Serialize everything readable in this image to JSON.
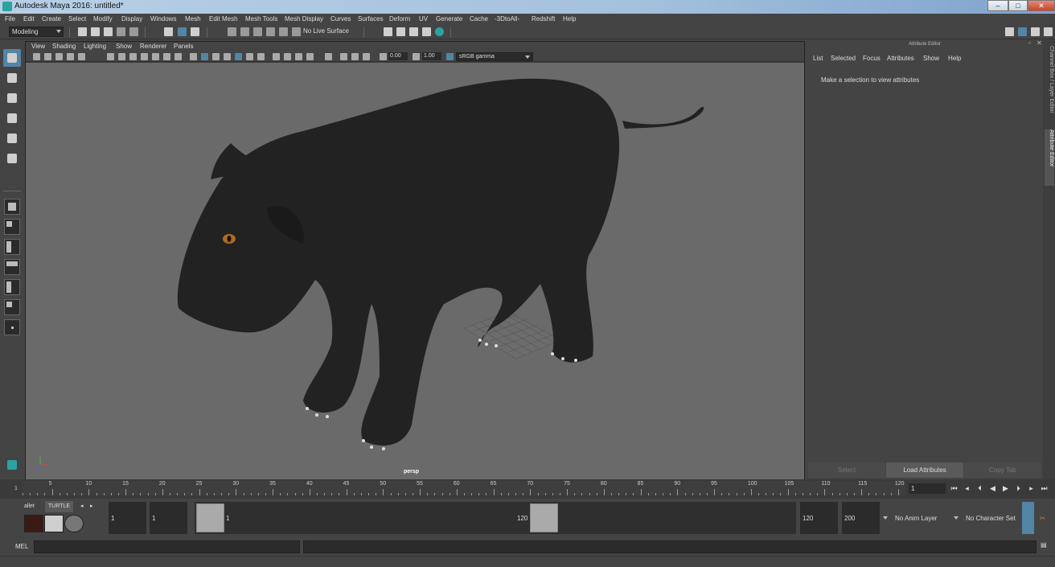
{
  "window": {
    "title": "Autodesk Maya 2016: untitled*",
    "controls": [
      "–",
      "□",
      "✕"
    ]
  },
  "menubar": [
    "File",
    "Edit",
    "Create",
    "Select",
    "Modify",
    "Display",
    "Windows",
    "Mesh",
    "Edit Mesh",
    "Mesh Tools",
    "Mesh Display",
    "Curves",
    "Surfaces",
    "Deform",
    "UV",
    "Generate",
    "Cache",
    "-3DtoAll-",
    "Redshift",
    "Help"
  ],
  "status_line": {
    "mode": "Modeling",
    "live_surface": "No Live Surface"
  },
  "viewport": {
    "menu": [
      "View",
      "Shading",
      "Lighting",
      "Show",
      "Renderer",
      "Panels"
    ],
    "exposure": "0.00",
    "gamma_value": "1.00",
    "color_space": "sRGB gamma",
    "camera": "persp"
  },
  "attribute_editor": {
    "title": "Attribute Editor",
    "menu": [
      "List",
      "Selected",
      "Focus",
      "Attributes",
      "Show",
      "Help"
    ],
    "message": "Make a selection to view attributes",
    "buttons": [
      "Select",
      "Load Attributes",
      "Copy Tab"
    ]
  },
  "side_tabs": [
    "Channel Box / Layer Editor",
    "Attribute Editor"
  ],
  "time_slider": {
    "ticks": [
      "5",
      "10",
      "15",
      "20",
      "25",
      "30",
      "35",
      "40",
      "45",
      "50",
      "55",
      "60",
      "65",
      "70",
      "75",
      "80",
      "85",
      "90",
      "95",
      "100",
      "105",
      "110",
      "115",
      "120"
    ],
    "start_label": "1",
    "current_frame": "1"
  },
  "range_slider": {
    "shelf_tabs": [
      "allet",
      "TURTLE"
    ],
    "start_time": "1",
    "playback_start": "1",
    "range_start": "1",
    "range_end": "120",
    "playback_end": "120",
    "end_time": "200",
    "anim_layer": "No Anim Layer",
    "character_set": "No Character Set"
  },
  "command_line": {
    "label": "MEL"
  },
  "colors": {
    "accent": "#5285a6",
    "viewport_bg": "#6a6a6a",
    "panel_bg": "#444444"
  }
}
